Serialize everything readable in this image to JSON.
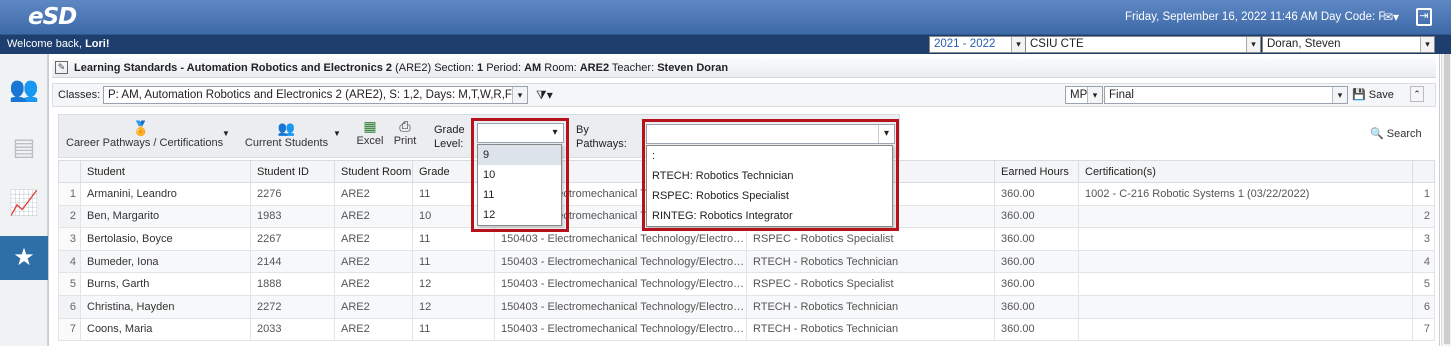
{
  "header": {
    "logo": "eSD",
    "datetime": "Friday, September 16, 2022   11:46 AM   Day Code: F",
    "mail_icon": "mail-icon",
    "exit_icon": "logout-icon"
  },
  "welcome": {
    "prefix": "Welcome back, ",
    "name": "Lori!"
  },
  "context": {
    "year": "2021 - 2022",
    "building": "CSIU CTE",
    "user": "Doran, Steven"
  },
  "sidenav": [
    "users-icon",
    "gradebook-icon",
    "analytics-icon",
    "learning-standards-icon"
  ],
  "page": {
    "title_bold": "Learning Standards - Automation Robotics and Electronics 2",
    "title_rest": " (ARE2) Section: ",
    "section": "1",
    "period_label": " Period: ",
    "period": "AM",
    "room_label": " Room: ",
    "room": "ARE2",
    "teacher_label": " Teacher: ",
    "teacher": "Steven Doran"
  },
  "classes": {
    "label": "Classes:",
    "value": "P: AM, Automation Robotics and Electronics  2 (ARE2), S: 1,2, Days: M,T,W,R,F (",
    "mp_value": "MP",
    "term_value": "Final",
    "save_label": "Save"
  },
  "toolbar": {
    "career": "Career Pathways / Certifications",
    "students": "Current Students",
    "excel": "Excel",
    "print": "Print",
    "grade_level_line1": "Grade",
    "grade_level_line2": "Level:",
    "pathways_line1": "By",
    "pathways_line2": "Pathways:",
    "search": "Search"
  },
  "grade_options": [
    "9",
    "10",
    "11",
    "12"
  ],
  "pathway_options": [
    ":",
    "RTECH: Robotics Technician",
    "RSPEC: Robotics Specialist",
    "RINTEG: Robotics Integrator"
  ],
  "columns": [
    "Student",
    "Student ID",
    "Student Room",
    "Grade",
    "",
    "",
    "Earned Hours",
    "Certification(s)"
  ],
  "rows": [
    {
      "n": "1",
      "student": "Armanini, Leandro",
      "id": "2276",
      "room": "ARE2",
      "grade": "11",
      "program": "150403 - Electromechanical Technology/Electrom...",
      "pathway": "",
      "hours": "360.00",
      "cert": "1002 - C-216 Robotic Systems 1 (03/22/2022)",
      "rn": "1"
    },
    {
      "n": "2",
      "student": "Ben, Margarito",
      "id": "1983",
      "room": "ARE2",
      "grade": "10",
      "program": "150403 - Electromechanical Technology/Electrom...",
      "pathway": "",
      "hours": "360.00",
      "cert": "",
      "rn": "2"
    },
    {
      "n": "3",
      "student": "Bertolasio, Boyce",
      "id": "2267",
      "room": "ARE2",
      "grade": "11",
      "program": "150403 - Electromechanical Technology/Electrom...",
      "pathway": "RSPEC - Robotics Specialist",
      "hours": "360.00",
      "cert": "",
      "rn": "3"
    },
    {
      "n": "4",
      "student": "Bumeder, Iona",
      "id": "2144",
      "room": "ARE2",
      "grade": "11",
      "program": "150403 - Electromechanical Technology/Electrom...",
      "pathway": "RTECH - Robotics Technician",
      "hours": "360.00",
      "cert": "",
      "rn": "4"
    },
    {
      "n": "5",
      "student": "Burns, Garth",
      "id": "1888",
      "room": "ARE2",
      "grade": "12",
      "program": "150403 - Electromechanical Technology/Electrom...",
      "pathway": "RSPEC - Robotics Specialist",
      "hours": "360.00",
      "cert": "",
      "rn": "5"
    },
    {
      "n": "6",
      "student": "Christina, Hayden",
      "id": "2272",
      "room": "ARE2",
      "grade": "12",
      "program": "150403 - Electromechanical Technology/Electrom...",
      "pathway": "RTECH - Robotics Technician",
      "hours": "360.00",
      "cert": "",
      "rn": "6"
    },
    {
      "n": "7",
      "student": "Coons, Maria",
      "id": "2033",
      "room": "ARE2",
      "grade": "11",
      "program": "150403 - Electromechanical Technology/Electrom...",
      "pathway": "RTECH - Robotics Technician",
      "hours": "360.00",
      "cert": "",
      "rn": "7"
    }
  ],
  "colors": {
    "header_blue": "#4a76b4",
    "welcome_navy": "#1e3f6e",
    "highlight_red": "#b5121b",
    "active_nav": "#2f6fa7"
  }
}
